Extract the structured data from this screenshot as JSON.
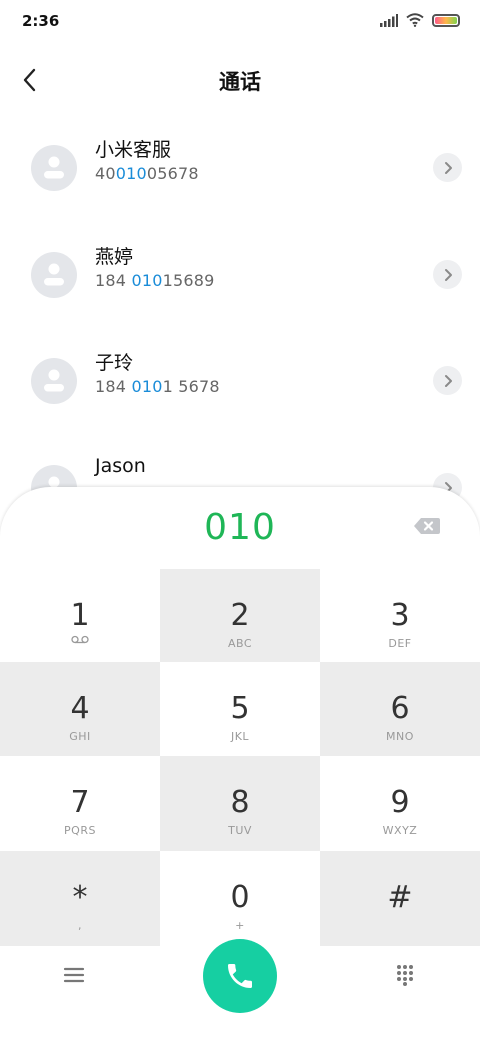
{
  "status": {
    "time": "2:36"
  },
  "header": {
    "title": "通话"
  },
  "contacts": [
    {
      "name": "小米客服",
      "number_pre": "40",
      "number_match": "010",
      "number_post": "05678"
    },
    {
      "name": "燕婷",
      "number_pre": "184 ",
      "number_match": "010",
      "number_post": "15689"
    },
    {
      "name": "子玲",
      "number_pre": "184 ",
      "number_match": "010",
      "number_post": "1 5678"
    },
    {
      "name": "Jason",
      "number_pre": "",
      "number_match": "",
      "number_post": ""
    }
  ],
  "dialer": {
    "display": "010",
    "keys": [
      {
        "digit": "1",
        "letters": ""
      },
      {
        "digit": "2",
        "letters": "ABC"
      },
      {
        "digit": "3",
        "letters": "DEF"
      },
      {
        "digit": "4",
        "letters": "GHI"
      },
      {
        "digit": "5",
        "letters": "JKL"
      },
      {
        "digit": "6",
        "letters": "MNO"
      },
      {
        "digit": "7",
        "letters": "PQRS"
      },
      {
        "digit": "8",
        "letters": "TUV"
      },
      {
        "digit": "9",
        "letters": "WXYZ"
      },
      {
        "digit": "*",
        "letters": ","
      },
      {
        "digit": "0",
        "letters": "+"
      },
      {
        "digit": "#",
        "letters": ""
      }
    ]
  },
  "icons": {
    "back": "back-arrow-icon",
    "chevron": "chevron-right-icon",
    "delete": "backspace-icon",
    "voicemail": "voicemail-icon",
    "menu": "menu-icon",
    "call": "phone-icon",
    "keypad": "dialpad-icon"
  },
  "colors": {
    "accent_green": "#1fb657",
    "call_button": "#16cfa2",
    "match_highlight": "#1a8cd8"
  }
}
